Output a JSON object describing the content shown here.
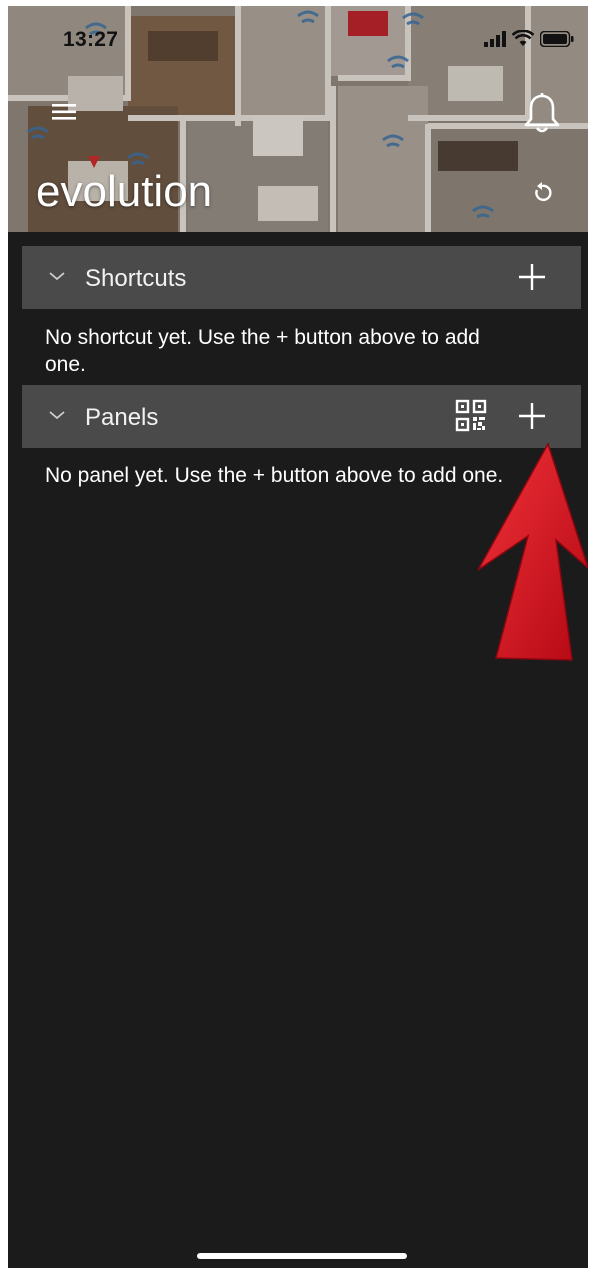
{
  "status_bar": {
    "time": "13:27"
  },
  "header": {
    "title": "evolution",
    "menu_icon": "hamburger-menu-icon",
    "notification_icon": "bell-icon",
    "refresh_icon": "refresh-icon"
  },
  "sections": {
    "shortcuts": {
      "label": "Shortcuts",
      "empty_message": "No shortcut yet. Use the + button above to add one."
    },
    "panels": {
      "label": "Panels",
      "empty_message": "No panel yet. Use the + button above to add one."
    }
  },
  "colors": {
    "background": "#1b1b1b",
    "section_bar": "#4a4a4a",
    "text": "#ffffff",
    "annotation_arrow": "#d8101e"
  }
}
